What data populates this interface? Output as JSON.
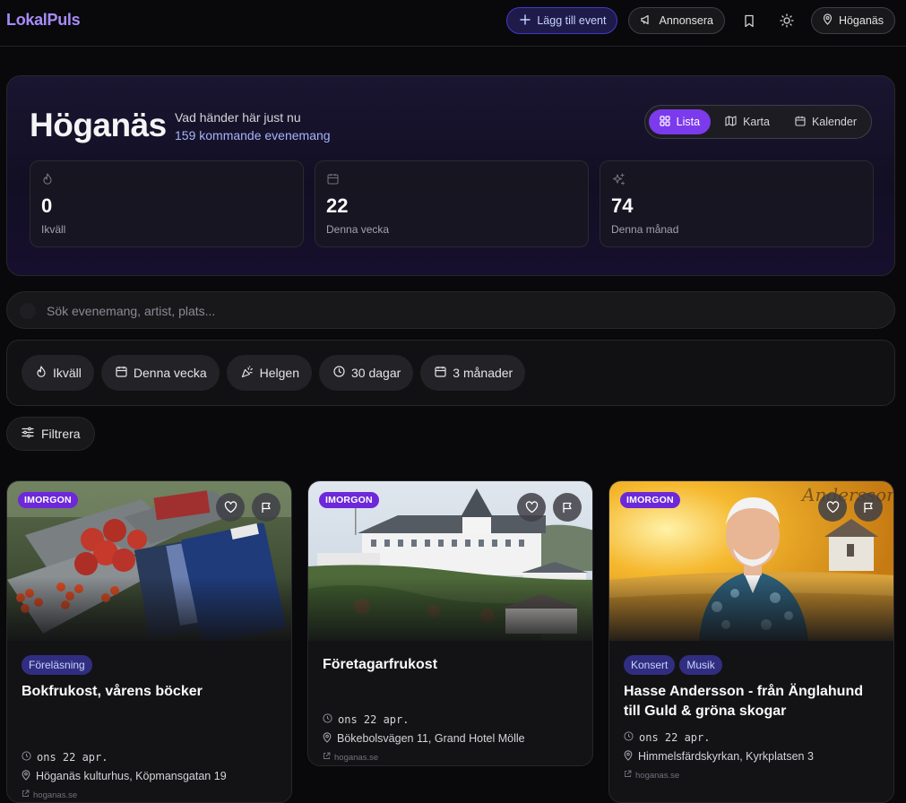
{
  "app": {
    "logo": "LokalPuls"
  },
  "nav": {
    "add_event": "Lägg till event",
    "advertise": "Annonsera",
    "location": "Höganäs"
  },
  "hero": {
    "title": "Höganäs",
    "subtitle": "Vad händer här just nu",
    "count": "159 kommande evenemang",
    "views": [
      {
        "label": "Lista",
        "active": true
      },
      {
        "label": "Karta",
        "active": false
      },
      {
        "label": "Kalender",
        "active": false
      }
    ],
    "stats": [
      {
        "value": "0",
        "label": "Ikväll",
        "icon": "flame-icon"
      },
      {
        "value": "22",
        "label": "Denna vecka",
        "icon": "calendar-icon"
      },
      {
        "value": "74",
        "label": "Denna månad",
        "icon": "sparkles-icon"
      }
    ]
  },
  "search": {
    "placeholder": "Sök evenemang, artist, plats..."
  },
  "quick_filters": [
    {
      "label": "Ikväll",
      "icon": "flame-icon"
    },
    {
      "label": "Denna vecka",
      "icon": "calendar-icon"
    },
    {
      "label": "Helgen",
      "icon": "party-popper-icon"
    },
    {
      "label": "30 dagar",
      "icon": "clock-icon"
    },
    {
      "label": "3 månader",
      "icon": "calendar-icon"
    }
  ],
  "filter_button": "Filtrera",
  "cards": [
    {
      "badge": "IMORGON",
      "tags": [
        "Föreläsning"
      ],
      "title": "Bokfrukost, vårens böcker",
      "date": "ons 22 apr.",
      "place": "Höganäs kulturhus, Köpmansgatan 19",
      "source": "hoganas.se"
    },
    {
      "badge": "IMORGON",
      "tags": [],
      "title": "Företagarfrukost",
      "date": "ons 22 apr.",
      "place": "Bökebolsvägen 11, Grand Hotel Mölle",
      "source": "hoganas.se"
    },
    {
      "badge": "IMORGON",
      "tags": [
        "Konsert",
        "Musik"
      ],
      "title": "Hasse Andersson - från Änglahund till Guld & gröna skogar",
      "date": "ons 22 apr.",
      "place": "Himmelsfärdskyrkan, Kyrkplatsen 3",
      "source": "hoganas.se"
    }
  ],
  "colors": {
    "accent": "#7c3aed",
    "badge": "#6d28d9",
    "link": "#a5b4fc",
    "background": "#09090b"
  }
}
